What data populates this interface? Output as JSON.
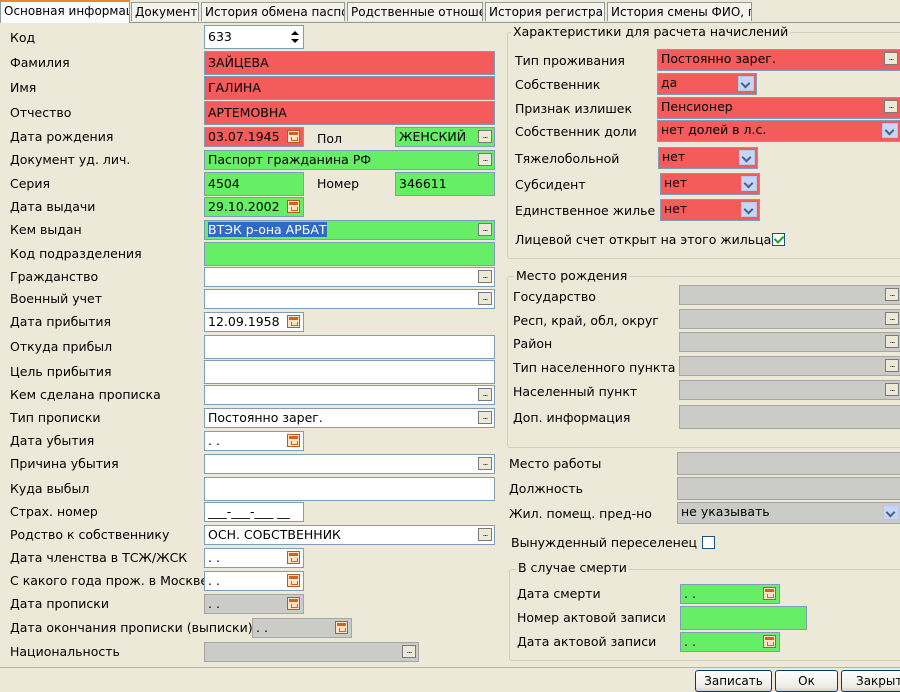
{
  "tabs": [
    "Основная информация",
    "Документы",
    "История обмена паспорта",
    "Родственные отношения",
    "История регистрации",
    "История смены ФИО, г.р."
  ],
  "left": {
    "kod": {
      "label": "Код",
      "value": "633"
    },
    "familia": {
      "label": "Фамилия",
      "value": "ЗАЙЦЕВА"
    },
    "imya": {
      "label": "Имя",
      "value": "ГАЛИНА"
    },
    "otchestvo": {
      "label": "Отчество",
      "value": "АРТЕМОВНА"
    },
    "birth_date": {
      "label": "Дата рождения",
      "value": "03.07.1945"
    },
    "pol": {
      "label": "Пол",
      "value": "ЖЕНСКИЙ"
    },
    "doc": {
      "label": "Документ уд. лич.",
      "value": "Паспорт гражданина РФ"
    },
    "seria": {
      "label": "Серия",
      "value": "4504"
    },
    "nomer": {
      "label": "Номер",
      "value": "346611"
    },
    "issue_date": {
      "label": "Дата выдачи",
      "value": "29.10.2002"
    },
    "issued_by": {
      "label": "Кем выдан",
      "value": "ВТЭК р-она АРБАТ"
    },
    "dept_code": {
      "label": "Код подразделения",
      "value": ""
    },
    "citizenship": {
      "label": "Гражданство",
      "value": ""
    },
    "military": {
      "label": "Военный учет",
      "value": ""
    },
    "arrival_date": {
      "label": "Дата прибытия",
      "value": "12.09.1958"
    },
    "from": {
      "label": "Откуда прибыл",
      "value": ""
    },
    "purpose": {
      "label": "Цель прибытия",
      "value": ""
    },
    "registered_by": {
      "label": "Кем сделана прописка",
      "value": ""
    },
    "reg_type": {
      "label": "Тип прописки",
      "value": "Постоянно зарег."
    },
    "depart_date": {
      "label": "Дата убытия",
      "value": " .  ."
    },
    "depart_reason": {
      "label": "Причина убытия",
      "value": ""
    },
    "depart_to": {
      "label": "Куда выбыл",
      "value": ""
    },
    "insurance": {
      "label": "Страх. номер",
      "value": "___-___-___ __"
    },
    "relation": {
      "label": "Родство к собственнику",
      "value": "ОСН. СОБСТВЕННИК"
    },
    "tszh_date": {
      "label": "Дата членства в ТСЖ/ЖСК",
      "value": " .  ."
    },
    "moscow_since": {
      "label": "С какого года прож. в Москве",
      "value": " .  ."
    },
    "reg_date": {
      "label": "Дата прописки",
      "value": " .  ."
    },
    "reg_end_date": {
      "label": "Дата окончания прописки (выписки)",
      "value": " .  ."
    },
    "nationality": {
      "label": "Национальность",
      "value": ""
    }
  },
  "charges": {
    "title": "Характеристики для расчета начислений",
    "residence_type": {
      "label": "Тип проживания",
      "value": "Постоянно зарег."
    },
    "owner": {
      "label": "Собственник",
      "value": "да"
    },
    "surplus": {
      "label": "Признак излишек",
      "value": "Пенсионер"
    },
    "share_owner": {
      "label": "Собственник доли",
      "value": "нет долей в л.с."
    },
    "ill": {
      "label": "Тяжелобольной",
      "value": "нет"
    },
    "subsidy": {
      "label": "Субсидент",
      "value": "нет"
    },
    "only_home": {
      "label": "Единственное жилье",
      "value": "нет"
    },
    "account_open": {
      "label": "Лицевой счет открыт на этого жильца",
      "checked": true
    }
  },
  "birthplace": {
    "title": "Место рождения",
    "state": {
      "label": "Государство",
      "value": ""
    },
    "region": {
      "label": "Респ, край, обл, округ",
      "value": ""
    },
    "district": {
      "label": "Район",
      "value": ""
    },
    "settlement_type": {
      "label": "Тип населенного пункта",
      "value": ""
    },
    "settlement": {
      "label": "Населенный пункт",
      "value": ""
    },
    "extra": {
      "label": "Доп. информация",
      "value": ""
    }
  },
  "work": {
    "place": {
      "label": "Место работы",
      "value": ""
    },
    "position": {
      "label": "Должность",
      "value": ""
    },
    "housing": {
      "label": "Жил. помещ. пред-но",
      "value": "не указывать"
    },
    "forced": {
      "label": "Вынужденный переселенец",
      "checked": false
    }
  },
  "death": {
    "title": "В случае смерти",
    "date": {
      "label": "Дата смерти",
      "value": " .  ."
    },
    "record_no": {
      "label": "Номер актовой записи",
      "value": ""
    },
    "record_date": {
      "label": "Дата актовой записи",
      "value": " .  ."
    }
  },
  "buttons": {
    "save": "Записать",
    "ok": "Ок",
    "close": "Закрыть"
  }
}
